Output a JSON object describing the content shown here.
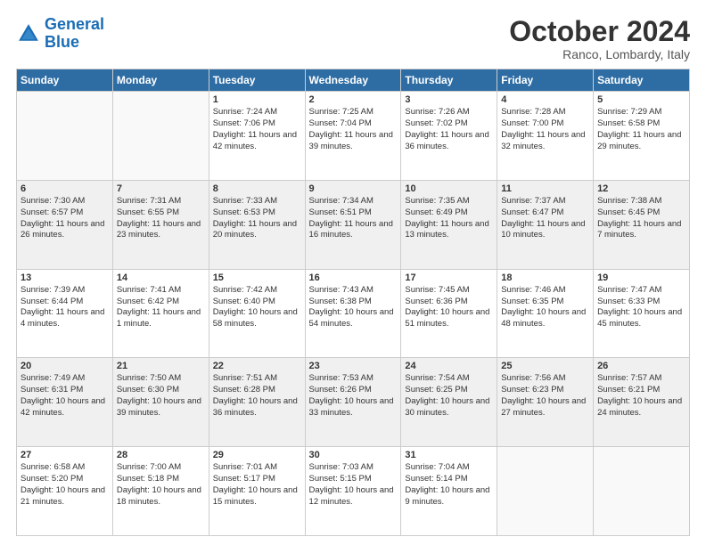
{
  "logo": {
    "line1": "General",
    "line2": "Blue"
  },
  "header": {
    "month": "October 2024",
    "location": "Ranco, Lombardy, Italy"
  },
  "weekdays": [
    "Sunday",
    "Monday",
    "Tuesday",
    "Wednesday",
    "Thursday",
    "Friday",
    "Saturday"
  ],
  "weeks": [
    [
      {
        "day": "",
        "content": ""
      },
      {
        "day": "",
        "content": ""
      },
      {
        "day": "1",
        "content": "Sunrise: 7:24 AM\nSunset: 7:06 PM\nDaylight: 11 hours and 42 minutes."
      },
      {
        "day": "2",
        "content": "Sunrise: 7:25 AM\nSunset: 7:04 PM\nDaylight: 11 hours and 39 minutes."
      },
      {
        "day": "3",
        "content": "Sunrise: 7:26 AM\nSunset: 7:02 PM\nDaylight: 11 hours and 36 minutes."
      },
      {
        "day": "4",
        "content": "Sunrise: 7:28 AM\nSunset: 7:00 PM\nDaylight: 11 hours and 32 minutes."
      },
      {
        "day": "5",
        "content": "Sunrise: 7:29 AM\nSunset: 6:58 PM\nDaylight: 11 hours and 29 minutes."
      }
    ],
    [
      {
        "day": "6",
        "content": "Sunrise: 7:30 AM\nSunset: 6:57 PM\nDaylight: 11 hours and 26 minutes."
      },
      {
        "day": "7",
        "content": "Sunrise: 7:31 AM\nSunset: 6:55 PM\nDaylight: 11 hours and 23 minutes."
      },
      {
        "day": "8",
        "content": "Sunrise: 7:33 AM\nSunset: 6:53 PM\nDaylight: 11 hours and 20 minutes."
      },
      {
        "day": "9",
        "content": "Sunrise: 7:34 AM\nSunset: 6:51 PM\nDaylight: 11 hours and 16 minutes."
      },
      {
        "day": "10",
        "content": "Sunrise: 7:35 AM\nSunset: 6:49 PM\nDaylight: 11 hours and 13 minutes."
      },
      {
        "day": "11",
        "content": "Sunrise: 7:37 AM\nSunset: 6:47 PM\nDaylight: 11 hours and 10 minutes."
      },
      {
        "day": "12",
        "content": "Sunrise: 7:38 AM\nSunset: 6:45 PM\nDaylight: 11 hours and 7 minutes."
      }
    ],
    [
      {
        "day": "13",
        "content": "Sunrise: 7:39 AM\nSunset: 6:44 PM\nDaylight: 11 hours and 4 minutes."
      },
      {
        "day": "14",
        "content": "Sunrise: 7:41 AM\nSunset: 6:42 PM\nDaylight: 11 hours and 1 minute."
      },
      {
        "day": "15",
        "content": "Sunrise: 7:42 AM\nSunset: 6:40 PM\nDaylight: 10 hours and 58 minutes."
      },
      {
        "day": "16",
        "content": "Sunrise: 7:43 AM\nSunset: 6:38 PM\nDaylight: 10 hours and 54 minutes."
      },
      {
        "day": "17",
        "content": "Sunrise: 7:45 AM\nSunset: 6:36 PM\nDaylight: 10 hours and 51 minutes."
      },
      {
        "day": "18",
        "content": "Sunrise: 7:46 AM\nSunset: 6:35 PM\nDaylight: 10 hours and 48 minutes."
      },
      {
        "day": "19",
        "content": "Sunrise: 7:47 AM\nSunset: 6:33 PM\nDaylight: 10 hours and 45 minutes."
      }
    ],
    [
      {
        "day": "20",
        "content": "Sunrise: 7:49 AM\nSunset: 6:31 PM\nDaylight: 10 hours and 42 minutes."
      },
      {
        "day": "21",
        "content": "Sunrise: 7:50 AM\nSunset: 6:30 PM\nDaylight: 10 hours and 39 minutes."
      },
      {
        "day": "22",
        "content": "Sunrise: 7:51 AM\nSunset: 6:28 PM\nDaylight: 10 hours and 36 minutes."
      },
      {
        "day": "23",
        "content": "Sunrise: 7:53 AM\nSunset: 6:26 PM\nDaylight: 10 hours and 33 minutes."
      },
      {
        "day": "24",
        "content": "Sunrise: 7:54 AM\nSunset: 6:25 PM\nDaylight: 10 hours and 30 minutes."
      },
      {
        "day": "25",
        "content": "Sunrise: 7:56 AM\nSunset: 6:23 PM\nDaylight: 10 hours and 27 minutes."
      },
      {
        "day": "26",
        "content": "Sunrise: 7:57 AM\nSunset: 6:21 PM\nDaylight: 10 hours and 24 minutes."
      }
    ],
    [
      {
        "day": "27",
        "content": "Sunrise: 6:58 AM\nSunset: 5:20 PM\nDaylight: 10 hours and 21 minutes."
      },
      {
        "day": "28",
        "content": "Sunrise: 7:00 AM\nSunset: 5:18 PM\nDaylight: 10 hours and 18 minutes."
      },
      {
        "day": "29",
        "content": "Sunrise: 7:01 AM\nSunset: 5:17 PM\nDaylight: 10 hours and 15 minutes."
      },
      {
        "day": "30",
        "content": "Sunrise: 7:03 AM\nSunset: 5:15 PM\nDaylight: 10 hours and 12 minutes."
      },
      {
        "day": "31",
        "content": "Sunrise: 7:04 AM\nSunset: 5:14 PM\nDaylight: 10 hours and 9 minutes."
      },
      {
        "day": "",
        "content": ""
      },
      {
        "day": "",
        "content": ""
      }
    ]
  ]
}
